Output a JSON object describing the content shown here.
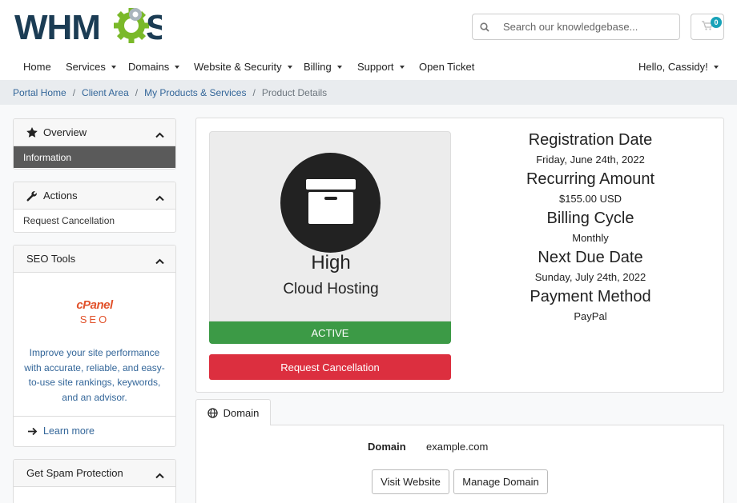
{
  "header": {
    "logo_text": "WHMCS",
    "search_placeholder": "Search our knowledgebase...",
    "cart_count": "0"
  },
  "nav": {
    "items": [
      {
        "label": "Home",
        "dropdown": false
      },
      {
        "label": "Services",
        "dropdown": true
      },
      {
        "label": "Domains",
        "dropdown": true
      },
      {
        "label": "Website & Security",
        "dropdown": true
      },
      {
        "label": "Billing",
        "dropdown": true
      },
      {
        "label": "Support",
        "dropdown": true
      },
      {
        "label": "Open Ticket",
        "dropdown": false
      }
    ],
    "account": "Hello, Cassidy!"
  },
  "breadcrumb": {
    "items": [
      "Portal Home",
      "Client Area",
      "My Products & Services"
    ],
    "current": "Product Details"
  },
  "sidebar": {
    "overview": {
      "title": "Overview",
      "items": [
        "Information"
      ]
    },
    "actions": {
      "title": "Actions",
      "items": [
        "Request Cancellation"
      ]
    },
    "seo_tools": {
      "title": "SEO Tools",
      "brand": "cPanel",
      "brand_sub": "SEO",
      "description": "Improve your site performance with accurate, reliable, and easy-to-use site rankings, keywords, and an advisor.",
      "link": "Learn more"
    },
    "spam": {
      "title": "Get Spam Protection"
    }
  },
  "product": {
    "name": "High",
    "group": "Cloud Hosting",
    "status": "ACTIVE",
    "cancel_label": "Request Cancellation",
    "info": [
      {
        "label": "Registration Date",
        "value": "Friday, June 24th, 2022"
      },
      {
        "label": "Recurring Amount",
        "value": "$155.00 USD"
      },
      {
        "label": "Billing Cycle",
        "value": "Monthly"
      },
      {
        "label": "Next Due Date",
        "value": "Sunday, July 24th, 2022"
      },
      {
        "label": "Payment Method",
        "value": "PayPal"
      }
    ]
  },
  "domain_tab": {
    "tab_label": "Domain",
    "field_label": "Domain",
    "field_value": "example.com",
    "visit_label": "Visit Website",
    "manage_label": "Manage Domain"
  },
  "colors": {
    "brand_navy": "#1b3c54",
    "brand_green": "#7ab929",
    "active_green": "#3c9a46",
    "danger_red": "#dc2f3f",
    "link_blue": "#336699",
    "cpanel_orange": "#e1522b",
    "badge_teal": "#17a2b8"
  },
  "icons": {
    "search": "search-icon",
    "cart": "cart-icon",
    "overview": "star-icon",
    "actions": "wrench-icon",
    "collapse": "chevron-up-icon",
    "product": "archive-box-icon",
    "domain_tab": "globe-icon",
    "learn_more": "arrow-right-icon"
  }
}
